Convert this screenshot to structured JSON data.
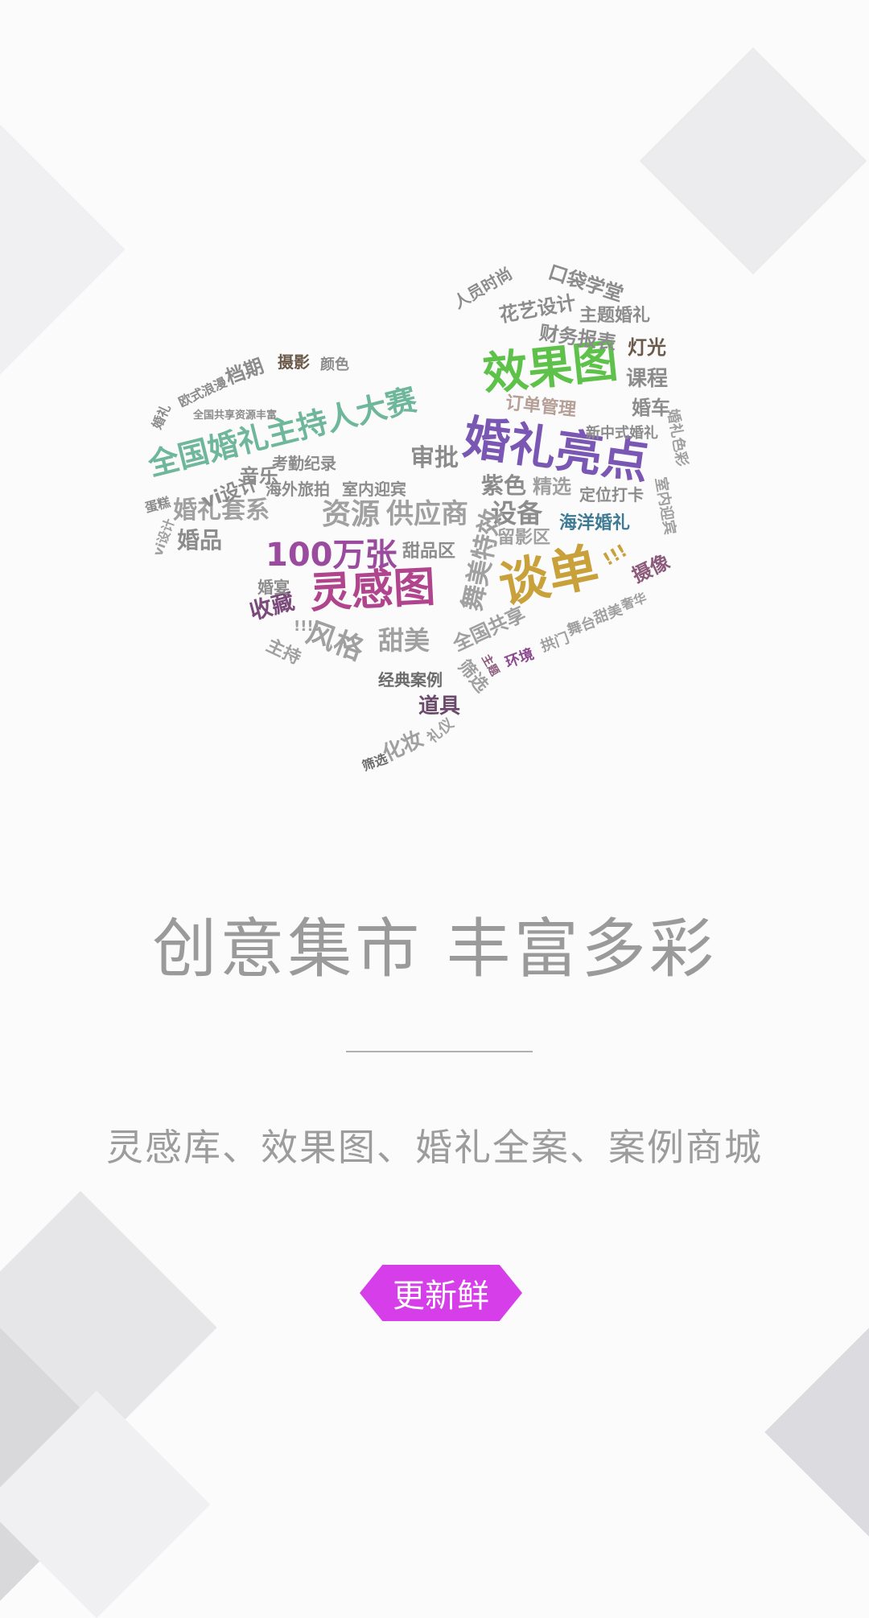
{
  "headline": "创意集市  丰富多彩",
  "subheadline": "灵感库、效果图、婚礼全案、案例商城",
  "cta_label": "更新鲜",
  "colors": {
    "accent": "#d53ee8",
    "background": "#fbfbfc",
    "text_gray": "#9a9a9a"
  },
  "word_cloud": [
    {
      "text": "效果图",
      "color": "#5ec24a"
    },
    {
      "text": "婚礼亮点",
      "color": "#7b57b4"
    },
    {
      "text": "全国婚礼主持人大赛",
      "color": "#6fb79a"
    },
    {
      "text": "灵感图",
      "color": "#b0458e"
    },
    {
      "text": "100万张",
      "color": "#9a4b9e"
    },
    {
      "text": "谈单",
      "color": "#c9a13b"
    },
    {
      "text": "资源",
      "color": "#a0a0a0"
    },
    {
      "text": "供应商",
      "color": "#a0a0a0"
    },
    {
      "text": "审批",
      "color": "#8c8c8c"
    },
    {
      "text": "紫色",
      "color": "#8c8c8c"
    },
    {
      "text": "设备",
      "color": "#8c8c8c"
    },
    {
      "text": "海洋婚礼",
      "color": "#3e7a93"
    },
    {
      "text": "订单管理",
      "color": "#b59f97"
    },
    {
      "text": "课程",
      "color": "#8c8c8c"
    },
    {
      "text": "灯光",
      "color": "#6b5a4a"
    },
    {
      "text": "婚车",
      "color": "#8c8c8c"
    },
    {
      "text": "财务报表",
      "color": "#8c8c8c"
    },
    {
      "text": "主题婚礼",
      "color": "#8c8c8c"
    },
    {
      "text": "花艺设计",
      "color": "#8c8c8c"
    },
    {
      "text": "口袋学堂",
      "color": "#8c8c8c"
    },
    {
      "text": "人员时尚",
      "color": "#8c8c8c"
    },
    {
      "text": "婚礼套系",
      "color": "#a0a0a0"
    },
    {
      "text": "婚品",
      "color": "#8c8c8c"
    },
    {
      "text": "vi设计",
      "color": "#8c8c8c"
    },
    {
      "text": "音乐",
      "color": "#8c8c8c"
    },
    {
      "text": "考勤纪录",
      "color": "#8c8c8c"
    },
    {
      "text": "海外旅拍",
      "color": "#8c8c8c"
    },
    {
      "text": "室内迎宾",
      "color": "#8c8c8c"
    },
    {
      "text": "甜品区",
      "color": "#8c8c8c"
    },
    {
      "text": "留影区",
      "color": "#a0a0a0"
    },
    {
      "text": "精选",
      "color": "#a0a0a0"
    },
    {
      "text": "定位打卡",
      "color": "#8c8c8c"
    },
    {
      "text": "新中式婚礼",
      "color": "#8c8c8c"
    },
    {
      "text": "舞美特效",
      "color": "#a0a0a0"
    },
    {
      "text": "风格",
      "color": "#a0a0a0"
    },
    {
      "text": "甜美",
      "color": "#a0a0a0"
    },
    {
      "text": "全国共享",
      "color": "#a0a0a0"
    },
    {
      "text": "摄像",
      "color": "#8c5a7a"
    },
    {
      "text": "环境",
      "color": "#8c4a8e"
    },
    {
      "text": "拱门",
      "color": "#a0a0a0"
    },
    {
      "text": "舞台",
      "color": "#a0a0a0"
    },
    {
      "text": "甜美",
      "color": "#a0a0a0"
    },
    {
      "text": "奢华",
      "color": "#a0a0a0"
    },
    {
      "text": "收藏",
      "color": "#7a4a7a"
    },
    {
      "text": "主持",
      "color": "#a0a0a0"
    },
    {
      "text": "经典案例",
      "color": "#6b6b6b"
    },
    {
      "text": "道具",
      "color": "#6b4a6b"
    },
    {
      "text": "筛选",
      "color": "#a0a0a0"
    },
    {
      "text": "主题",
      "color": "#8c5a7a"
    },
    {
      "text": "化妆",
      "color": "#a0a0a0"
    },
    {
      "text": "礼仪",
      "color": "#a0a0a0"
    },
    {
      "text": "筛选",
      "color": "#6b6b6b"
    },
    {
      "text": "档期",
      "color": "#8c8c8c"
    },
    {
      "text": "摄影",
      "color": "#6b5a4a"
    },
    {
      "text": "颜色",
      "color": "#8c8c8c"
    },
    {
      "text": "欧式浪漫",
      "color": "#8c8c8c"
    },
    {
      "text": "婚礼",
      "color": "#8c8c8c"
    },
    {
      "text": "全国共享资源丰富",
      "color": "#8c8c8c"
    },
    {
      "text": "蛋糕",
      "color": "#8c8c8c"
    },
    {
      "text": "vi设计",
      "color": "#a0a0a0"
    },
    {
      "text": "婚礼色彩",
      "color": "#a0a0a0"
    },
    {
      "text": "室内迎宾",
      "color": "#a0a0a0"
    },
    {
      "text": "婚宴",
      "color": "#8c8c8c"
    },
    {
      "text": "!!!",
      "color": "#c9a13b"
    },
    {
      "text": "!!!!",
      "color": "#a0a0a0"
    }
  ]
}
